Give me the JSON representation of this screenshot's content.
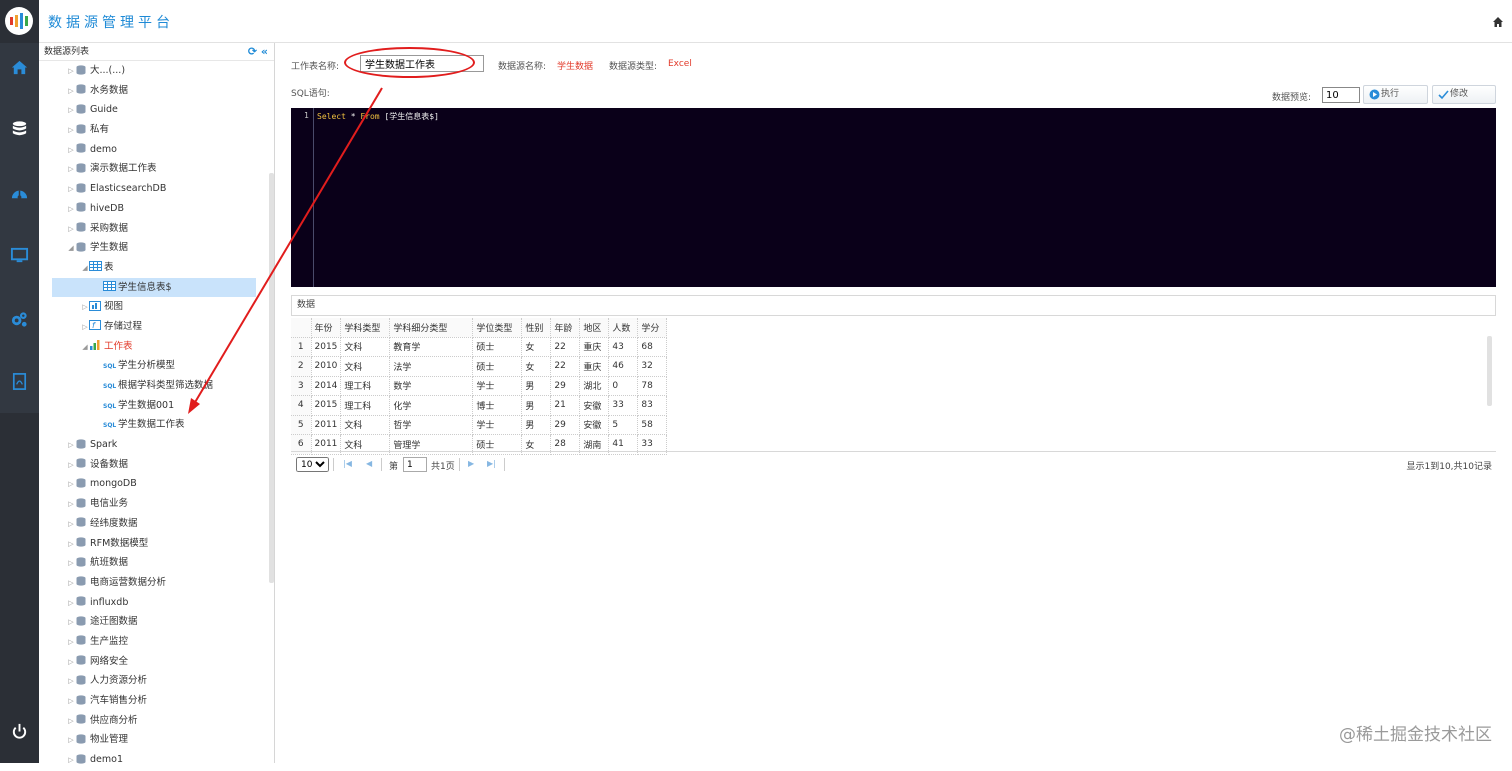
{
  "app": {
    "title": "数据源管理平台"
  },
  "rail": {
    "items": [
      "home-icon",
      "database-icon",
      "dashboard-icon",
      "monitor-icon",
      "settings-icon",
      "pdf-icon",
      "power-icon"
    ]
  },
  "tree": {
    "header": "数据源列表",
    "nodes": [
      {
        "label": "大...(...)",
        "level": 1,
        "icon": "db",
        "toggle": "▷"
      },
      {
        "label": "水务数据",
        "level": 1,
        "icon": "db",
        "toggle": "▷"
      },
      {
        "label": "Guide",
        "level": 1,
        "icon": "db",
        "toggle": "▷"
      },
      {
        "label": "私有",
        "level": 1,
        "icon": "db",
        "toggle": "▷"
      },
      {
        "label": "demo",
        "level": 1,
        "icon": "db",
        "toggle": "▷"
      },
      {
        "label": "演示数据工作表",
        "level": 1,
        "icon": "db",
        "toggle": "▷"
      },
      {
        "label": "ElasticsearchDB",
        "level": 1,
        "icon": "db",
        "toggle": "▷"
      },
      {
        "label": "hiveDB",
        "level": 1,
        "icon": "db",
        "toggle": "▷"
      },
      {
        "label": "采购数据",
        "level": 1,
        "icon": "db",
        "toggle": "▷"
      },
      {
        "label": "学生数据",
        "level": 1,
        "icon": "db",
        "toggle": "◢"
      },
      {
        "label": "表",
        "level": 2,
        "icon": "table",
        "toggle": "◢"
      },
      {
        "label": "学生信息表$",
        "level": 3,
        "icon": "table",
        "toggle": "",
        "selected": true
      },
      {
        "label": "视图",
        "level": 2,
        "icon": "view",
        "toggle": "▷"
      },
      {
        "label": "存储过程",
        "level": 2,
        "icon": "proc",
        "toggle": "▷"
      },
      {
        "label": "工作表",
        "level": 2,
        "icon": "chart",
        "toggle": "◢",
        "red": true
      },
      {
        "label": "学生分析模型",
        "level": 3,
        "icon": "sql",
        "toggle": ""
      },
      {
        "label": "根据学科类型筛选数据",
        "level": 3,
        "icon": "sql",
        "toggle": ""
      },
      {
        "label": "学生数据001",
        "level": 3,
        "icon": "sql",
        "toggle": ""
      },
      {
        "label": "学生数据工作表",
        "level": 3,
        "icon": "sql",
        "toggle": ""
      },
      {
        "label": "Spark",
        "level": 1,
        "icon": "db",
        "toggle": "▷"
      },
      {
        "label": "设备数据",
        "level": 1,
        "icon": "db",
        "toggle": "▷"
      },
      {
        "label": "mongoDB",
        "level": 1,
        "icon": "db",
        "toggle": "▷"
      },
      {
        "label": "电信业务",
        "level": 1,
        "icon": "db",
        "toggle": "▷"
      },
      {
        "label": "经纬度数据",
        "level": 1,
        "icon": "db",
        "toggle": "▷"
      },
      {
        "label": "RFM数据模型",
        "level": 1,
        "icon": "db",
        "toggle": "▷"
      },
      {
        "label": "航班数据",
        "level": 1,
        "icon": "db",
        "toggle": "▷"
      },
      {
        "label": "电商运营数据分析",
        "level": 1,
        "icon": "db",
        "toggle": "▷"
      },
      {
        "label": "influxdb",
        "level": 1,
        "icon": "db",
        "toggle": "▷"
      },
      {
        "label": "途迁图数据",
        "level": 1,
        "icon": "db",
        "toggle": "▷"
      },
      {
        "label": "生产监控",
        "level": 1,
        "icon": "db",
        "toggle": "▷"
      },
      {
        "label": "网络安全",
        "level": 1,
        "icon": "db",
        "toggle": "▷"
      },
      {
        "label": "人力资源分析",
        "level": 1,
        "icon": "db",
        "toggle": "▷"
      },
      {
        "label": "汽车销售分析",
        "level": 1,
        "icon": "db",
        "toggle": "▷"
      },
      {
        "label": "供应商分析",
        "level": 1,
        "icon": "db",
        "toggle": "▷"
      },
      {
        "label": "物业管理",
        "level": 1,
        "icon": "db",
        "toggle": "▷"
      },
      {
        "label": "demo1",
        "level": 1,
        "icon": "db",
        "toggle": "▷"
      }
    ]
  },
  "form": {
    "worksheet_label": "工作表名称:",
    "worksheet_value": "学生数据工作表",
    "datasource_label": "数据源名称:",
    "datasource_value": "学生数据",
    "datasource_type_label": "数据源类型:",
    "datasource_type_value": "Excel",
    "sql_label": "SQL语句:",
    "preview_label": "数据预览:",
    "preview_value": "10",
    "run_button": "执行",
    "edit_button": "修改"
  },
  "editor": {
    "line_number": "1",
    "code_keyword1": "Select",
    "code_mid": " * ",
    "code_keyword2": "From",
    "code_rest": " [学生信息表$]"
  },
  "data_panel": {
    "title": "数据"
  },
  "grid": {
    "columns": [
      "年份",
      "学科类型",
      "学科细分类型",
      "学位类型",
      "性别",
      "年龄",
      "地区",
      "人数",
      "学分"
    ],
    "rows": [
      [
        "1",
        "2015",
        "文科",
        "教育学",
        "硕士",
        "女",
        "22",
        "重庆",
        "43",
        "68"
      ],
      [
        "2",
        "2010",
        "文科",
        "法学",
        "硕士",
        "女",
        "22",
        "重庆",
        "46",
        "32"
      ],
      [
        "3",
        "2014",
        "理工科",
        "数学",
        "学士",
        "男",
        "29",
        "湖北",
        "0",
        "78"
      ],
      [
        "4",
        "2015",
        "理工科",
        "化学",
        "博士",
        "男",
        "21",
        "安徽",
        "33",
        "83"
      ],
      [
        "5",
        "2011",
        "文科",
        "哲学",
        "学士",
        "男",
        "29",
        "安徽",
        "5",
        "58"
      ],
      [
        "6",
        "2011",
        "文科",
        "管理学",
        "硕士",
        "女",
        "28",
        "湖南",
        "41",
        "33"
      ]
    ]
  },
  "pager": {
    "page_size": "10",
    "page_prefix": "第",
    "page_value": "1",
    "page_total": "共1页",
    "info": "显示1到10,共10记录"
  },
  "watermark": "@稀土掘金技术社区",
  "colors": {
    "accent": "#1e8ad6",
    "danger": "#e23b2b",
    "sidebar": "#2b2f36",
    "editor_bg": "#0a0019",
    "selected": "#c9e3fb"
  }
}
